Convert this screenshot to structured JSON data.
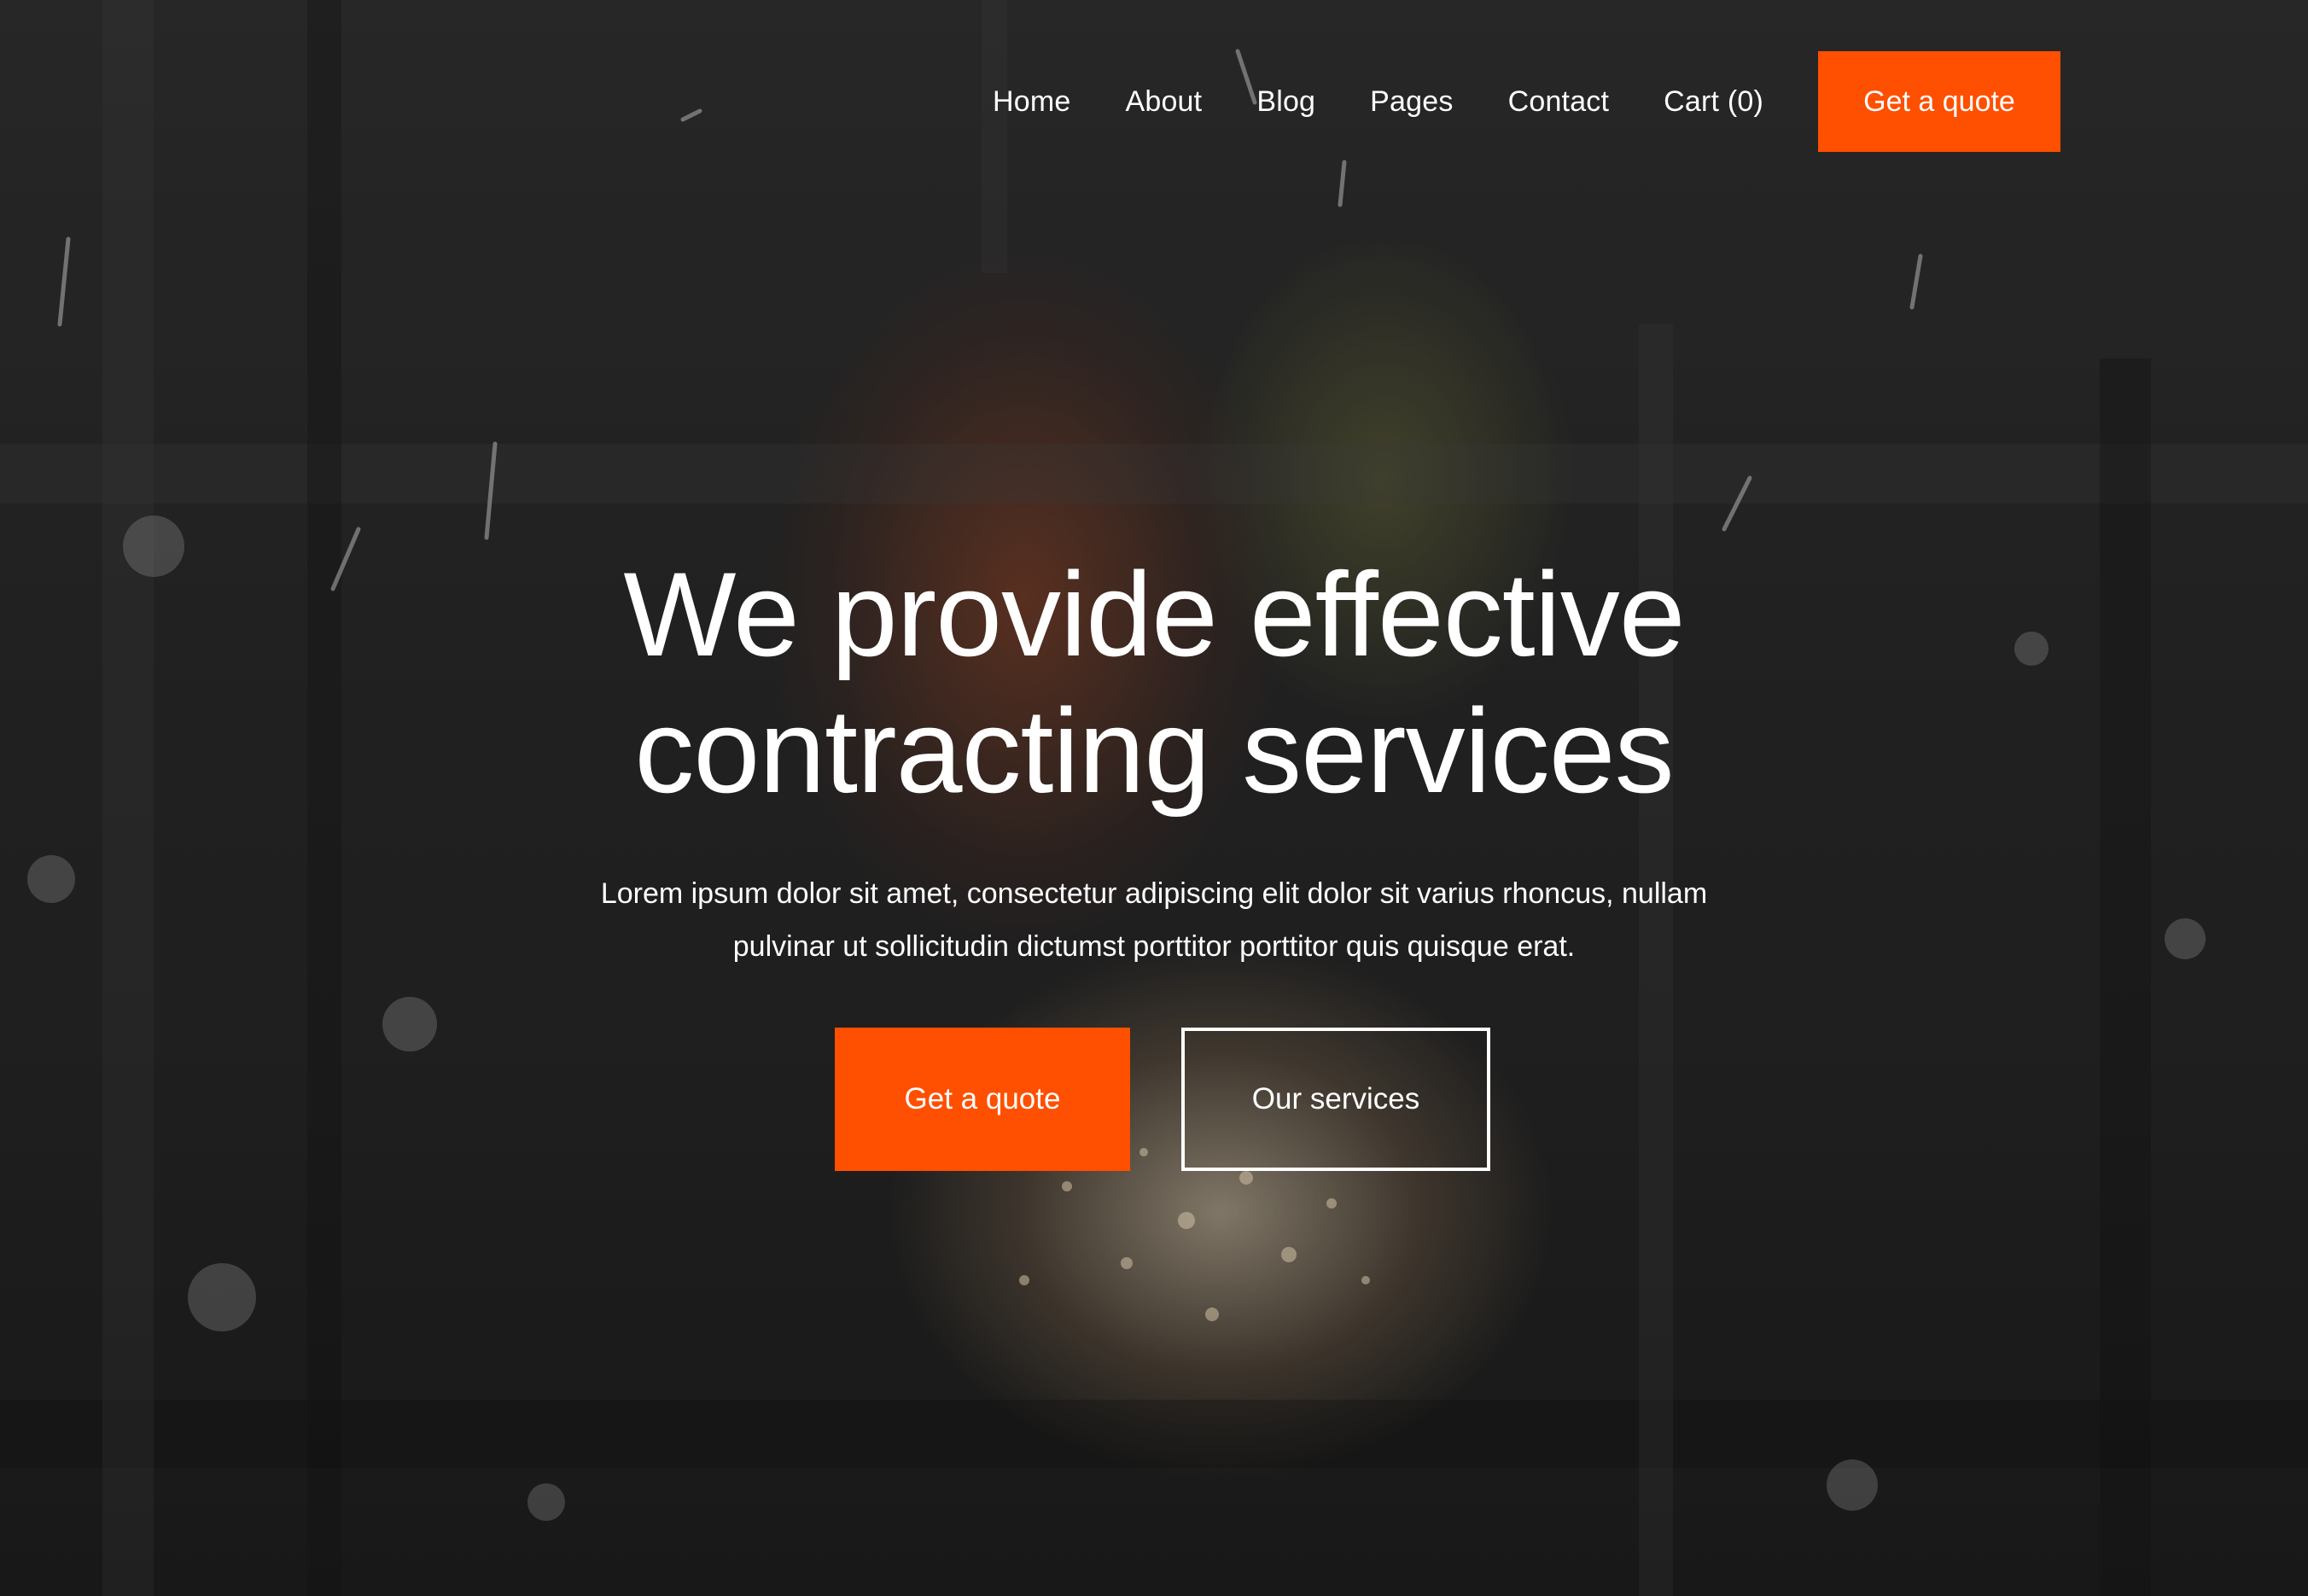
{
  "nav": {
    "items": [
      {
        "label": "Home"
      },
      {
        "label": "About"
      },
      {
        "label": "Blog"
      },
      {
        "label": "Pages"
      },
      {
        "label": "Contact"
      },
      {
        "label": "Cart (0)"
      }
    ],
    "cta_label": "Get a quote"
  },
  "hero": {
    "headline": "We provide effective contracting services",
    "subtext": "Lorem ipsum dolor sit amet, consectetur adipiscing elit dolor sit varius rhoncus, nullam pulvinar ut sollicitudin dictumst porttitor porttitor quis quisque erat.",
    "primary_button": "Get a quote",
    "secondary_button": "Our services"
  },
  "colors": {
    "accent": "#ff4f00",
    "text": "#ffffff"
  }
}
